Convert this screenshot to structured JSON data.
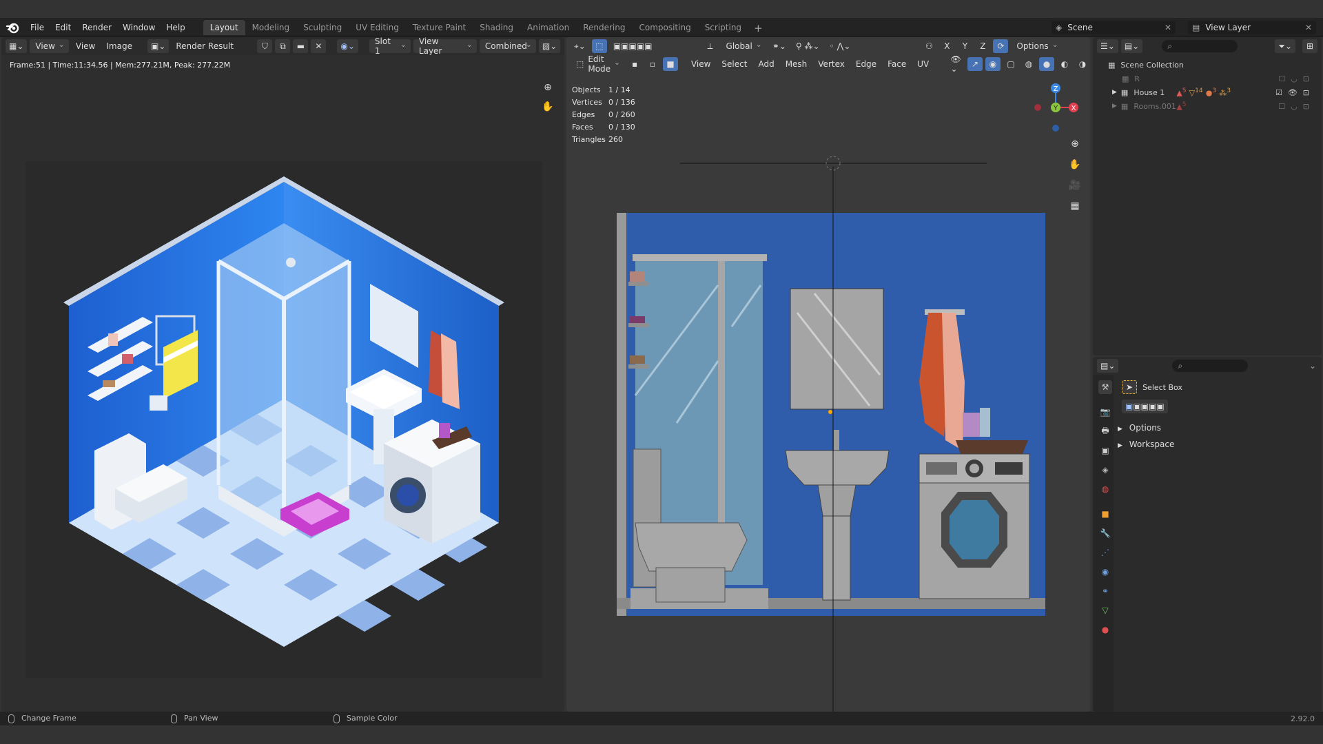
{
  "menus": [
    "File",
    "Edit",
    "Render",
    "Window",
    "Help"
  ],
  "workspaces": [
    "Layout",
    "Modeling",
    "Sculpting",
    "UV Editing",
    "Texture Paint",
    "Shading",
    "Animation",
    "Rendering",
    "Compositing",
    "Scripting"
  ],
  "active_workspace": "Layout",
  "scene": {
    "scene_name": "Scene",
    "view_layer": "View Layer"
  },
  "image_editor": {
    "view_label": "View",
    "menu_view": "View",
    "menu_image": "Image",
    "image_name": "Render Result",
    "slot": "Slot 1",
    "layer": "View Layer",
    "pass": "Combined",
    "frame_info": "Frame:51 | Time:11:34.56 | Mem:277.21M, Peak: 277.22M"
  },
  "viewport": {
    "mode": "Edit Mode",
    "menus": [
      "View",
      "Select",
      "Add",
      "Mesh",
      "Vertex",
      "Edge",
      "Face",
      "UV"
    ],
    "orientation": "Global",
    "options_label": "Options",
    "axes": [
      "X",
      "Y",
      "Z"
    ],
    "stats": [
      {
        "label": "Objects",
        "value": "1 / 14"
      },
      {
        "label": "Vertices",
        "value": "0 / 136"
      },
      {
        "label": "Edges",
        "value": "0 / 260"
      },
      {
        "label": "Faces",
        "value": "0 / 130"
      },
      {
        "label": "Triangles",
        "value": "260"
      }
    ],
    "gizmo": {
      "z": "Z",
      "y": "Y",
      "x": "X"
    }
  },
  "outliner": {
    "root": "Scene Collection",
    "items": [
      {
        "name": "R"
      },
      {
        "name": "House 1",
        "badges": [
          "5",
          "14",
          "3",
          "3"
        ]
      },
      {
        "name": "Rooms.001",
        "badges": [
          "5"
        ]
      }
    ]
  },
  "properties": {
    "tool_name": "Select Box",
    "sections": [
      "Options",
      "Workspace"
    ]
  },
  "statusbar": {
    "items": [
      "Change Frame",
      "Pan View",
      "Sample Color"
    ],
    "version": "2.92.0"
  },
  "colors": {
    "accent_blue": "#4772b3",
    "header_bg": "#2b2b2b",
    "wall_blue": "#2f5dab",
    "gizmo_x": "#e0404f",
    "gizmo_y": "#8cc63f",
    "gizmo_z": "#3d8ae6"
  }
}
